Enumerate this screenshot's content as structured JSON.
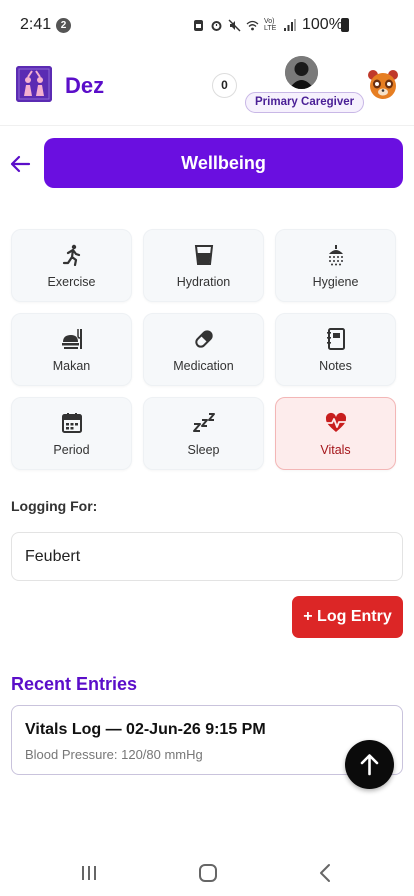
{
  "status": {
    "time": "2:41",
    "notification_count": "2",
    "volte_line1": "Vo)",
    "volte_line2": "LTE",
    "battery": "100%"
  },
  "header": {
    "app_name": "Dez",
    "count": "0",
    "role": "Primary Caregiver"
  },
  "page": {
    "title": "Wellbeing"
  },
  "categories": [
    {
      "label": "Exercise",
      "icon": "running-icon"
    },
    {
      "label": "Hydration",
      "icon": "glass-icon"
    },
    {
      "label": "Hygiene",
      "icon": "shower-icon"
    },
    {
      "label": "Makan",
      "icon": "food-icon"
    },
    {
      "label": "Medication",
      "icon": "pill-icon"
    },
    {
      "label": "Notes",
      "icon": "notebook-icon"
    },
    {
      "label": "Period",
      "icon": "calendar-icon"
    },
    {
      "label": "Sleep",
      "icon": "zzz-icon"
    },
    {
      "label": "Vitals",
      "icon": "heart-pulse-icon",
      "active": true
    }
  ],
  "logging": {
    "label": "Logging For:",
    "value": "Feubert",
    "button_label": "+ Log Entry"
  },
  "recent": {
    "title": "Recent Entries",
    "entries": [
      {
        "title": "Vitals Log — 02-Jun-26 9:15 PM",
        "subtitle": "Blood Pressure: 120/80 mmHg"
      }
    ]
  },
  "colors": {
    "brand": "#6a0fe0",
    "accent_red": "#dc2626",
    "heading_purple": "#5b0ec9"
  }
}
